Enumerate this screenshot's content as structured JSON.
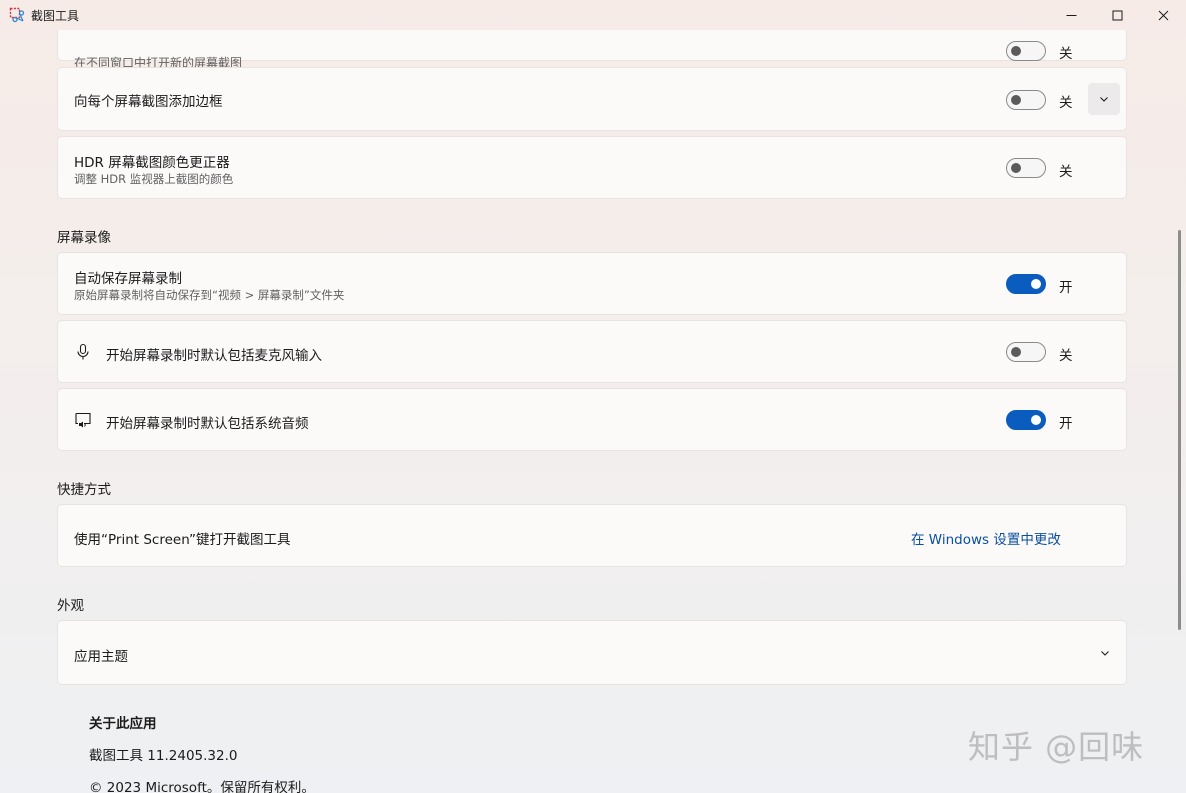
{
  "window": {
    "title": "截图工具"
  },
  "rows": {
    "new_window_sub": "在不同窗口中打开新的屏幕截图",
    "new_window_state": "关",
    "border_title": "向每个屏幕截图添加边框",
    "border_state": "关",
    "hdr_title": "HDR 屏幕截图颜色更正器",
    "hdr_sub": "调整 HDR 监视器上截图的颜色",
    "hdr_state": "关"
  },
  "recording": {
    "heading": "屏幕录像",
    "autosave_title": "自动保存屏幕录制",
    "autosave_sub": "原始屏幕录制将自动保存到“视频 > 屏幕录制”文件夹",
    "autosave_state": "开",
    "mic_title": "开始屏幕录制时默认包括麦克风输入",
    "mic_state": "关",
    "audio_title": "开始屏幕录制时默认包括系统音频",
    "audio_state": "开"
  },
  "shortcuts": {
    "heading": "快捷方式",
    "printscreen_title": "使用“Print Screen”键打开截图工具",
    "printscreen_link": "在 Windows 设置中更改"
  },
  "appearance": {
    "heading": "外观",
    "theme_title": "应用主题"
  },
  "about": {
    "heading": "关于此应用",
    "version": "截图工具 11.2405.32.0",
    "copyright": "© 2023 Microsoft。保留所有权利。"
  },
  "watermark": "知乎 @回味",
  "colors": {
    "accent": "#0b5cbf",
    "link": "#0a4f9e"
  },
  "icons": {
    "app": "snipping-tool-icon",
    "mic": "microphone-icon",
    "audio": "system-audio-icon",
    "expand": "chevron-down-icon"
  }
}
